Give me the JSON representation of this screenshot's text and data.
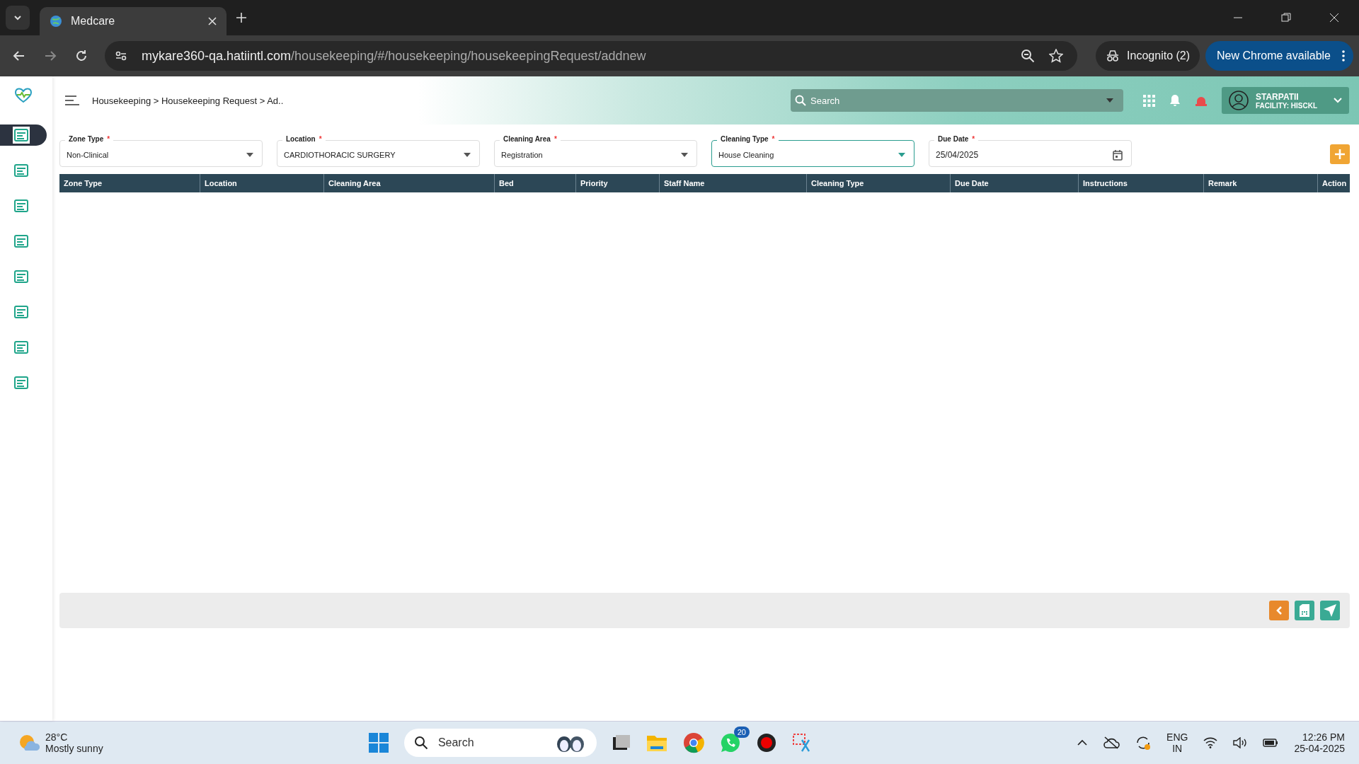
{
  "browser": {
    "tab_title": "Medcare",
    "url_host": "mykare360-qa.hatiintl.com",
    "url_path": "/housekeeping/#/housekeeping/housekeepingRequest/addnew",
    "incognito": "Incognito (2)",
    "update_button": "New Chrome available"
  },
  "sidebar": {
    "items": [
      {
        "selected": true
      },
      {
        "selected": false
      },
      {
        "selected": false
      },
      {
        "selected": false
      },
      {
        "selected": false
      },
      {
        "selected": false
      },
      {
        "selected": false
      },
      {
        "selected": false
      }
    ]
  },
  "header": {
    "breadcrumb": "Housekeeping > Housekeeping Request > Ad..",
    "search_placeholder": "Search",
    "user_name": "STARPATII",
    "facility": "FACILITY: HISCKL"
  },
  "form": {
    "fields": [
      {
        "label": "Zone Type",
        "required": "*",
        "value": "Non-Clinical",
        "kind": "dropdown",
        "focused": false
      },
      {
        "label": "Location",
        "required": "*",
        "value": "CARDIOTHORACIC SURGERY",
        "kind": "dropdown",
        "focused": false
      },
      {
        "label": "Cleaning Area",
        "required": "*",
        "value": "Registration",
        "kind": "dropdown",
        "focused": false
      },
      {
        "label": "Cleaning Type",
        "required": "*",
        "value": "House Cleaning",
        "kind": "dropdown",
        "focused": true
      },
      {
        "label": "Due Date",
        "required": "*",
        "value": "25/04/2025",
        "kind": "date",
        "focused": false
      }
    ]
  },
  "table": {
    "columns": [
      "Zone Type",
      "Location",
      "Cleaning Area",
      "Bed",
      "Priority",
      "Staff Name",
      "Cleaning Type",
      "Due Date",
      "Instructions",
      "Remark",
      "Action"
    ]
  },
  "taskbar": {
    "weather_temp": "28°C",
    "weather_text": "Mostly sunny",
    "search_placeholder": "Search",
    "whatsapp_badge": "20",
    "language": "ENG",
    "region": "IN",
    "time": "12:26 PM",
    "date": "25-04-2025"
  }
}
